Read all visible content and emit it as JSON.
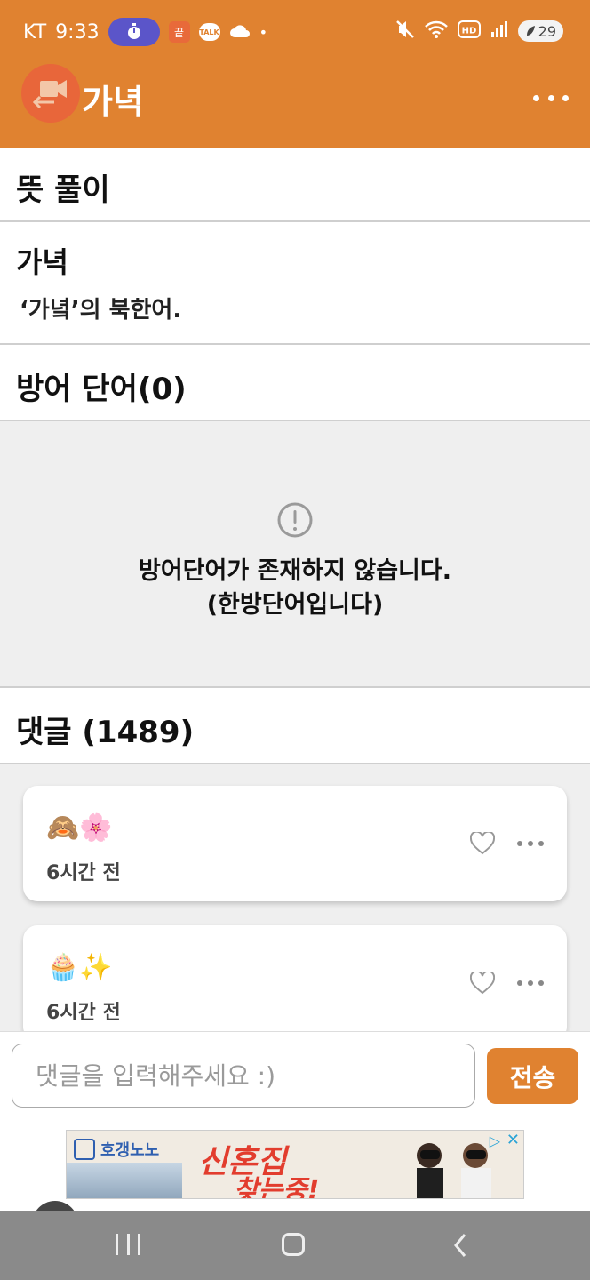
{
  "status_bar": {
    "carrier": "KT",
    "time": "9:33",
    "badge_text": "끝",
    "talk_text": "TALK",
    "dot": "•",
    "battery": "29"
  },
  "app_bar": {
    "title": "가녁"
  },
  "sections": {
    "meaning_header": "뜻 풀이",
    "word": "가녁",
    "definition": "‘가녘’의 북한어.",
    "defense_header": "방어 단어(0)",
    "empty_line1": "방어단어가 존재하지 않습니다.",
    "empty_line2": "(한방단어입니다)",
    "comments_header": "댓글 (1489)"
  },
  "comments": [
    {
      "content": "🙈🌸",
      "time": "6시간 전"
    },
    {
      "content": "🧁✨",
      "time": "6시간 전"
    }
  ],
  "input": {
    "placeholder": "댓글을 입력해주세요 :)",
    "send_label": "전송"
  },
  "ad": {
    "brand": "호갱노노",
    "headline1": "신혼집",
    "headline2": "찾는중!"
  },
  "colors": {
    "accent": "#e08230",
    "background_gray": "#efefef",
    "divider": "#cfcfcf"
  }
}
